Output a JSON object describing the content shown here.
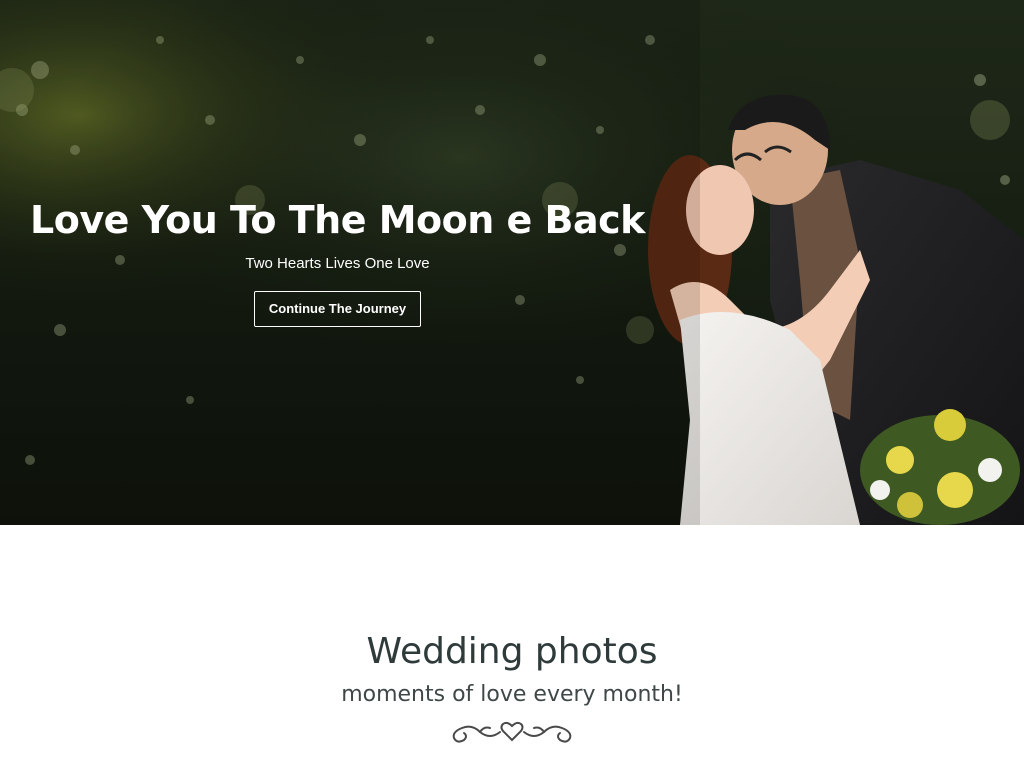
{
  "hero": {
    "title": "Love You To The Moon e Back",
    "subtitle": "Two Hearts Lives One Love",
    "button_label": "Continue The Journey",
    "image": "wedding-couple-photo"
  },
  "section": {
    "title": "Wedding photos",
    "subtitle": "moments of love every month!",
    "divider_icon": "heart-swirl-divider-icon"
  },
  "colors": {
    "hero_text": "#ffffff",
    "section_title": "#2f3a3a",
    "section_subtitle": "#3f4747",
    "divider": "#4a4a4a"
  }
}
